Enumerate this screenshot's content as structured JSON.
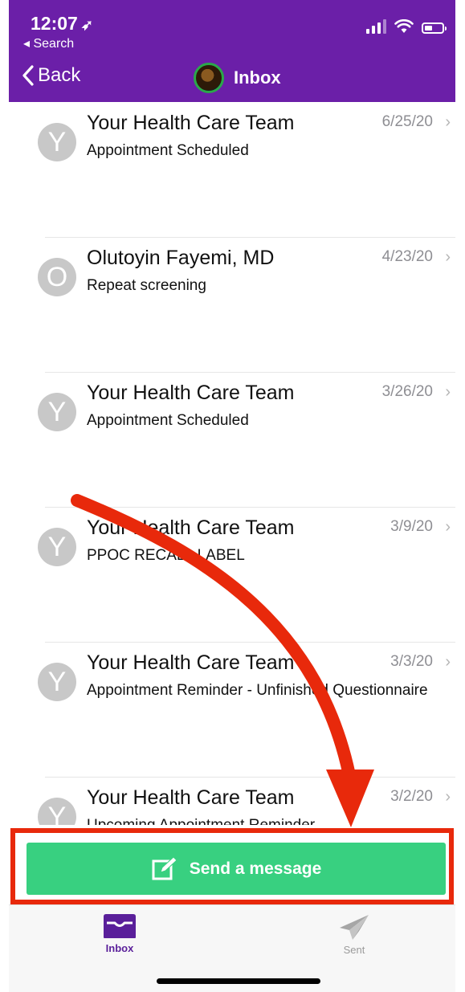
{
  "status_bar": {
    "time": "12:07",
    "back_app": "◂ Search"
  },
  "nav": {
    "back_label": "Back",
    "title": "Inbox"
  },
  "messages": [
    {
      "avatar": "Y",
      "sender": "Your Health Care Team",
      "subject": "Appointment Scheduled",
      "date": "6/25/20"
    },
    {
      "avatar": "O",
      "sender": "Olutoyin Fayemi, MD",
      "subject": "Repeat screening",
      "date": "4/23/20"
    },
    {
      "avatar": "Y",
      "sender": "Your Health Care Team",
      "subject": "Appointment Scheduled",
      "date": "3/26/20"
    },
    {
      "avatar": "Y",
      "sender": "Your Health Care Team",
      "subject": "PPOC RECALL LABEL",
      "date": "3/9/20"
    },
    {
      "avatar": "Y",
      "sender": "Your Health Care Team",
      "subject": "Appointment Reminder - Unfinished Questionnaire",
      "date": "3/3/20"
    },
    {
      "avatar": "Y",
      "sender": "Your Health Care Team",
      "subject": "Upcoming Appointment Reminder",
      "date": "3/2/20"
    }
  ],
  "send_button": {
    "label": "Send a message"
  },
  "tabs": {
    "inbox": "Inbox",
    "sent": "Sent"
  },
  "colors": {
    "header": "#6b1fa8",
    "send_button": "#38d080",
    "annotation": "#e8290b",
    "active_tab": "#5a1f9a"
  }
}
